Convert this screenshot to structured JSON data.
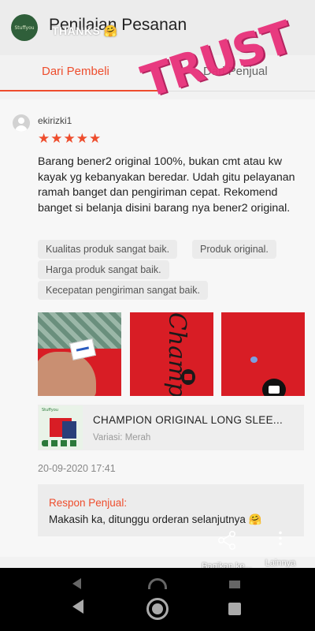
{
  "header": {
    "title": "Penilaian Pesanan",
    "story_avatar_text": "Stuffyou",
    "story_caption": "THANKS",
    "story_caption_suffix": "🤗"
  },
  "tabs": [
    {
      "label": "Dari Pembeli",
      "active": true
    },
    {
      "label": "Dari Penjual",
      "active": false
    }
  ],
  "overlay": {
    "sticker_text": "TRUST"
  },
  "review": {
    "username": "ekirizki1",
    "rating": 5,
    "stars": "★★★★★",
    "text": "Barang bener2 original 100%, bukan cmt atau kw kayak yg kebanyakan beredar. Udah gitu pelayanan ramah banget dan pengiriman cepat. Rekomend banget si belanja disini barang nya bener2 original.",
    "tags": [
      "Kualitas produk sangat baik.",
      "Produk original.",
      "Harga produk sangat baik.",
      "Kecepatan pengiriman sangat baik."
    ],
    "product": {
      "name": "CHAMPION ORIGINAL LONG SLEE...",
      "variant": "Variasi: Merah",
      "thumb_brand": "Stuffyou"
    },
    "date": "20-09-2020 17:41",
    "seller_response": {
      "title": "Respon Penjual:",
      "text": "Makasih ka, ditunggu orderan selanjutnya 🤗"
    }
  },
  "story_actions": {
    "share_label": "Bagikan ke...",
    "more_label": "Lainnya"
  },
  "colors": {
    "accent": "#ee4d2d",
    "sticker": "#e8317a",
    "product_red": "#d81d25"
  }
}
